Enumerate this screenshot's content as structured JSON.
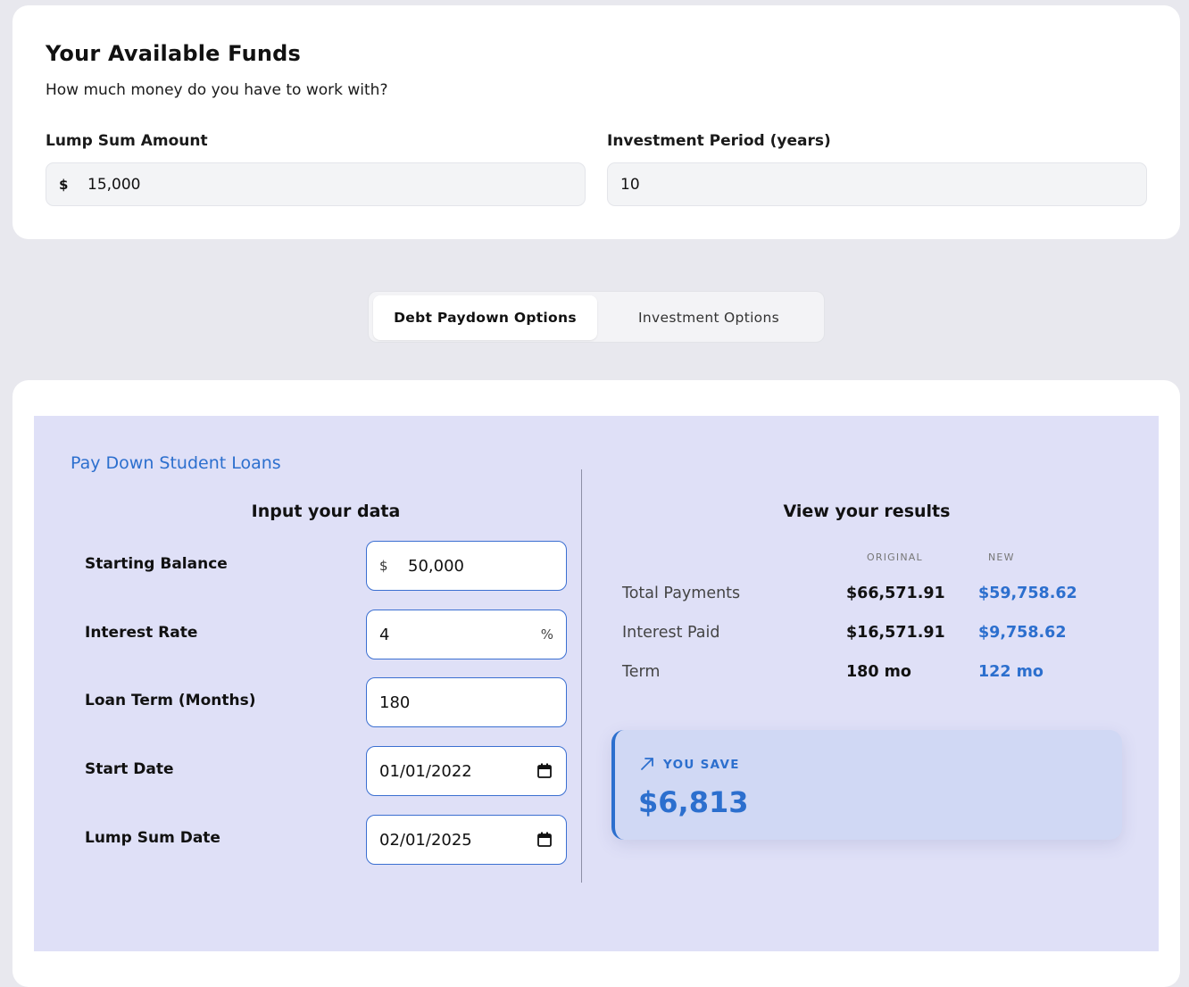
{
  "funds": {
    "title": "Your Available Funds",
    "subtitle": "How much money do you have to work with?",
    "lump_sum_label": "Lump Sum Amount",
    "lump_sum_prefix": "$",
    "lump_sum_value": "15,000",
    "period_label": "Investment Period (years)",
    "period_value": "10"
  },
  "tabs": [
    {
      "label": "Debt Paydown Options",
      "active": true
    },
    {
      "label": "Investment Options",
      "active": false
    }
  ],
  "loan": {
    "title": "Pay Down Student Loans",
    "input_heading": "Input your data",
    "results_heading": "View your results",
    "fields": {
      "starting_balance": {
        "label": "Starting Balance",
        "prefix": "$",
        "value": "50,000"
      },
      "interest_rate": {
        "label": "Interest Rate",
        "value": "4",
        "suffix": "%"
      },
      "loan_term": {
        "label": "Loan Term (Months)",
        "value": "180"
      },
      "start_date": {
        "label": "Start Date",
        "value": "01/01/2022"
      },
      "lump_sum_date": {
        "label": "Lump Sum Date",
        "value": "02/01/2025"
      }
    },
    "results": {
      "col_original": "ORIGINAL",
      "col_new": "NEW",
      "rows": [
        {
          "label": "Total Payments",
          "original": "$66,571.91",
          "new": "$59,758.62"
        },
        {
          "label": "Interest Paid",
          "original": "$16,571.91",
          "new": "$9,758.62"
        },
        {
          "label": "Term",
          "original": "180 mo",
          "new": "122 mo"
        }
      ]
    },
    "savings": {
      "label": "YOU SAVE",
      "amount": "$6,813",
      "icon": "trend-up-arrow-icon"
    }
  },
  "colors": {
    "accent": "#2c6fce",
    "panel_bg": "#dfe0f7",
    "page_bg": "#e8e8ee"
  }
}
